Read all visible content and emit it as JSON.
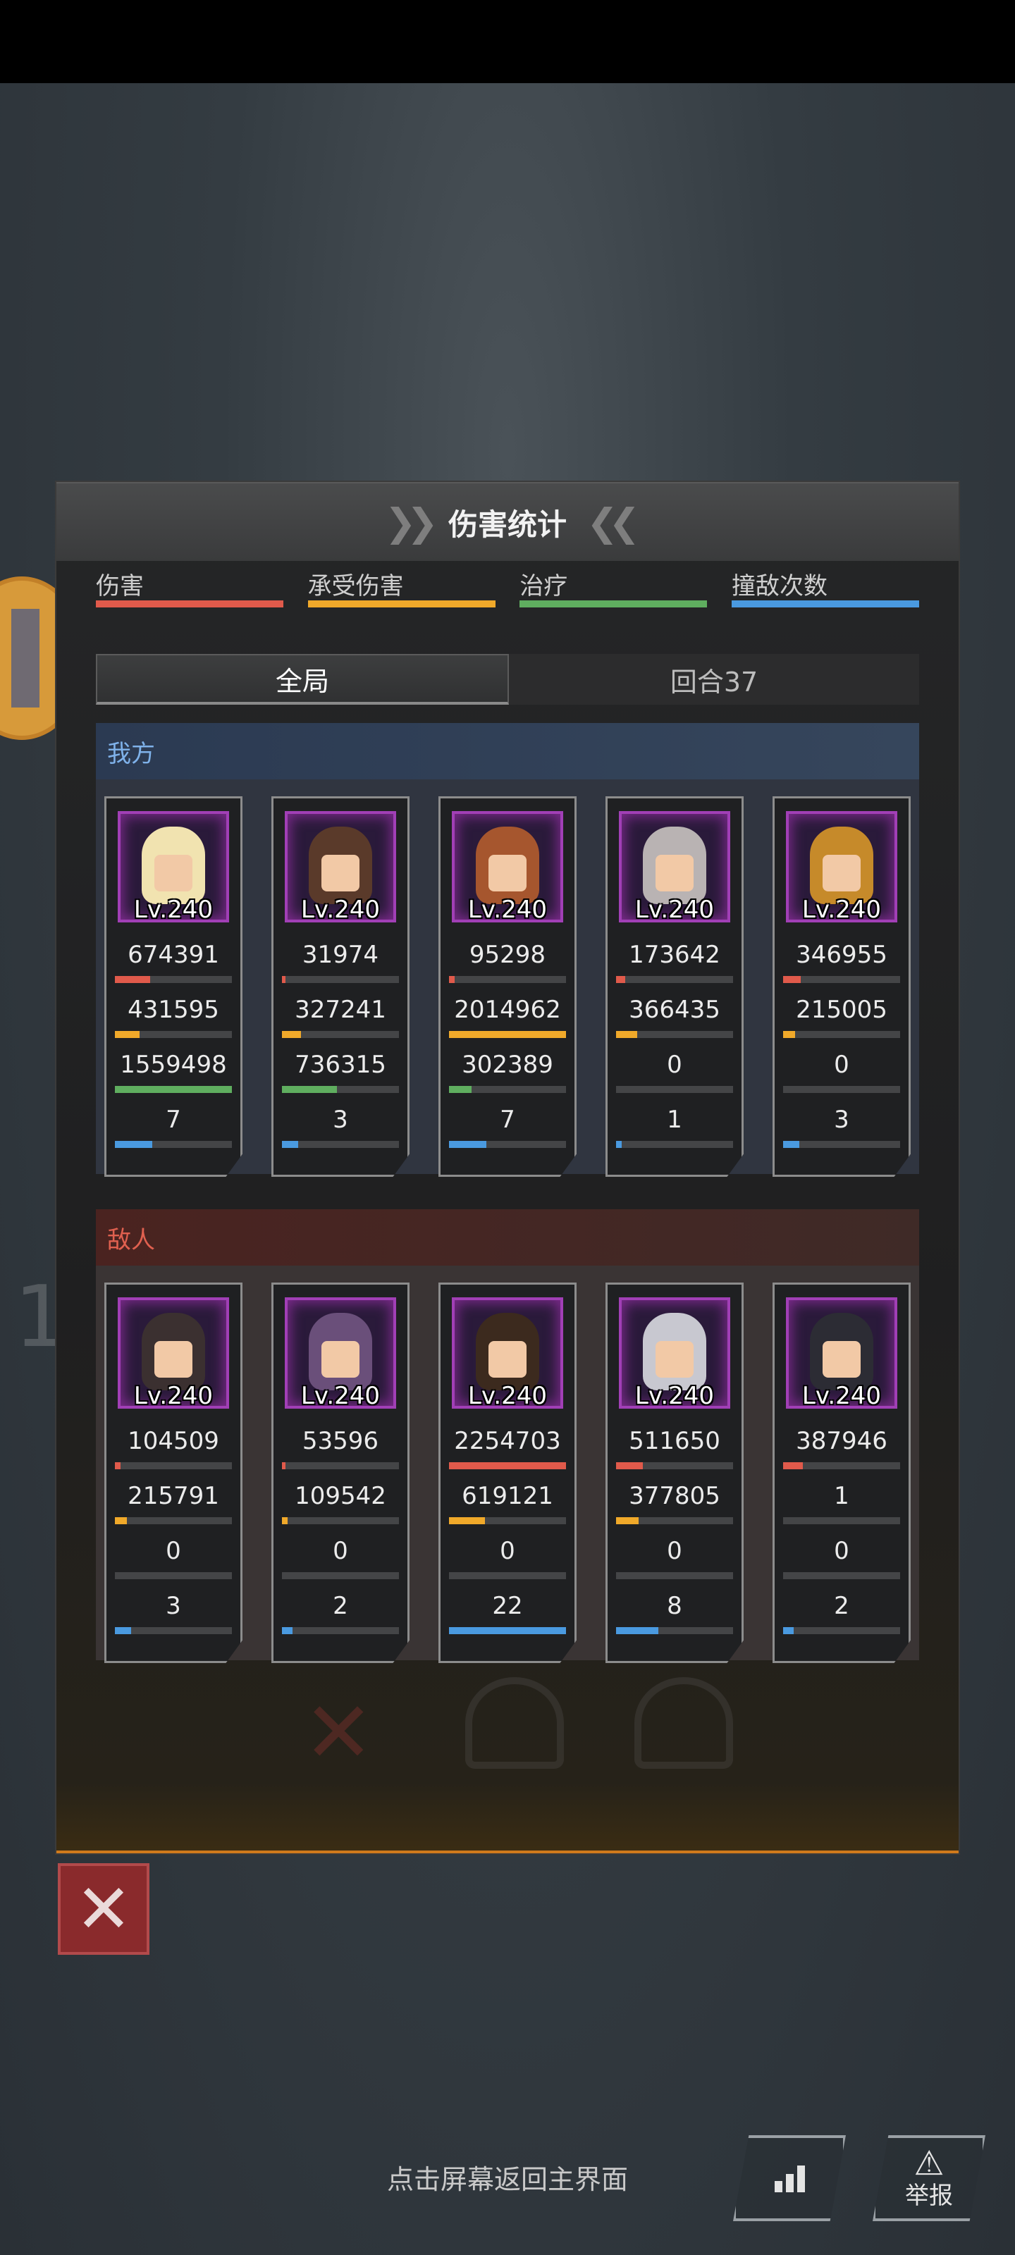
{
  "panel": {
    "title": "伤害统计"
  },
  "legend": [
    {
      "label": "伤害",
      "color": "#e05a4b"
    },
    {
      "label": "承受伤害",
      "color": "#f0a92a"
    },
    {
      "label": "治疗",
      "color": "#5fae5f"
    },
    {
      "label": "撞敌次数",
      "color": "#4a9ae0"
    }
  ],
  "tabs": {
    "overall": "全局",
    "round": "回合37"
  },
  "allies": {
    "label": "我方",
    "units": [
      {
        "level": "Lv.240",
        "stats": [
          "674391",
          "431595",
          "1559498",
          "7"
        ],
        "fill": [
          0.3,
          0.21,
          1.0,
          0.32
        ],
        "hair": "#f1e3b0"
      },
      {
        "level": "Lv.240",
        "stats": [
          "31974",
          "327241",
          "736315",
          "3"
        ],
        "fill": [
          0.03,
          0.16,
          0.47,
          0.14
        ],
        "hair": "#5a3a2a"
      },
      {
        "level": "Lv.240",
        "stats": [
          "95298",
          "2014962",
          "302389",
          "7"
        ],
        "fill": [
          0.05,
          1.0,
          0.19,
          0.32
        ],
        "hair": "#a6562e"
      },
      {
        "level": "Lv.240",
        "stats": [
          "173642",
          "366435",
          "0",
          "1"
        ],
        "fill": [
          0.08,
          0.18,
          0.0,
          0.05
        ],
        "hair": "#b9b3b3"
      },
      {
        "level": "Lv.240",
        "stats": [
          "346955",
          "215005",
          "0",
          "3"
        ],
        "fill": [
          0.15,
          0.1,
          0.0,
          0.14
        ],
        "hair": "#c68a2a"
      }
    ]
  },
  "enemies": {
    "label": "敌人",
    "units": [
      {
        "level": "Lv.240",
        "stats": [
          "104509",
          "215791",
          "0",
          "3"
        ],
        "fill": [
          0.05,
          0.1,
          0.0,
          0.14
        ],
        "hair": "#3b3030"
      },
      {
        "level": "Lv.240",
        "stats": [
          "53596",
          "109542",
          "0",
          "2"
        ],
        "fill": [
          0.03,
          0.05,
          0.0,
          0.09
        ],
        "hair": "#6a4f7a"
      },
      {
        "level": "Lv.240",
        "stats": [
          "2254703",
          "619121",
          "0",
          "22"
        ],
        "fill": [
          1.0,
          0.31,
          0.0,
          1.0
        ],
        "hair": "#3c2a1e"
      },
      {
        "level": "Lv.240",
        "stats": [
          "511650",
          "377805",
          "0",
          "8"
        ],
        "fill": [
          0.23,
          0.19,
          0.0,
          0.36
        ],
        "hair": "#c8c8d0"
      },
      {
        "level": "Lv.240",
        "stats": [
          "387946",
          "1",
          "0",
          "2"
        ],
        "fill": [
          0.17,
          0.0,
          0.0,
          0.09
        ],
        "hair": "#2c2c34"
      }
    ]
  },
  "footer": {
    "hint": "点击屏幕返回主界面",
    "report_label": "举报"
  },
  "icons": {
    "close": "close-icon",
    "stats": "bar-chart-icon",
    "report": "warning-icon"
  }
}
